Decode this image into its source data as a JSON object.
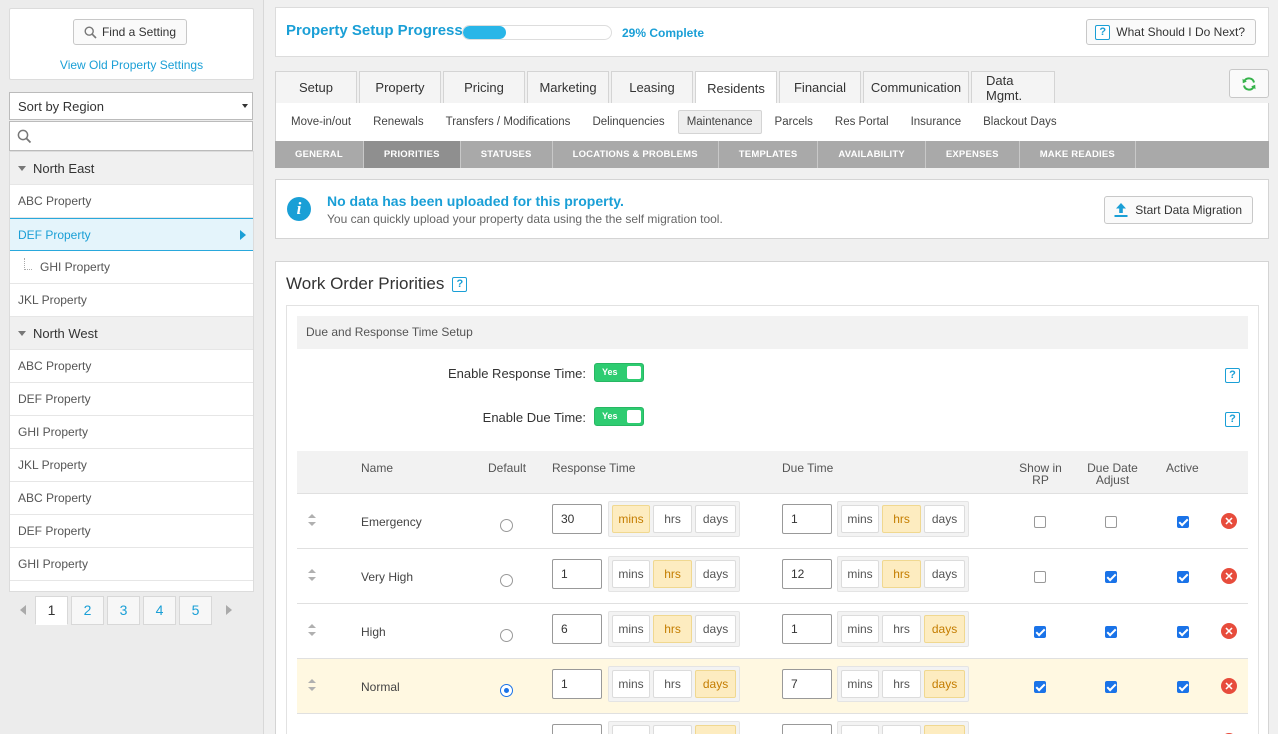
{
  "sidebar": {
    "find_label": "Find a Setting",
    "old_link": "View Old Property Settings",
    "sort_value": "Sort by Region",
    "search_placeholder": "",
    "tree": [
      {
        "label": "North East",
        "type": "region"
      },
      {
        "label": "ABC Property",
        "type": "item"
      },
      {
        "label": "DEF Property",
        "type": "active"
      },
      {
        "label": "GHI Property",
        "type": "child"
      },
      {
        "label": "JKL Property",
        "type": "item"
      },
      {
        "label": "North West",
        "type": "region"
      },
      {
        "label": "ABC Property",
        "type": "item"
      },
      {
        "label": "DEF Property",
        "type": "item"
      },
      {
        "label": "GHI Property",
        "type": "item"
      },
      {
        "label": "JKL Property",
        "type": "item"
      },
      {
        "label": "ABC Property",
        "type": "item"
      },
      {
        "label": "DEF Property",
        "type": "item"
      },
      {
        "label": "GHI Property",
        "type": "item"
      }
    ],
    "pages": [
      "1",
      "2",
      "3",
      "4",
      "5"
    ],
    "current_page": "1"
  },
  "progress": {
    "title": "Property Setup Progress",
    "percent": 29,
    "label": "29% Complete",
    "help_button": "What Should I Do Next?"
  },
  "tabs": [
    "Setup",
    "Property",
    "Pricing",
    "Marketing",
    "Leasing",
    "Residents",
    "Financial",
    "Communication",
    "Data Mgmt."
  ],
  "active_tab": "Residents",
  "subtabs": [
    "Move-in/out",
    "Renewals",
    "Transfers / Modifications",
    "Delinquencies",
    "Maintenance",
    "Parcels",
    "Res Portal",
    "Insurance",
    "Blackout Days"
  ],
  "active_subtab": "Maintenance",
  "subsubtabs": [
    "GENERAL",
    "PRIORITIES",
    "STATUSES",
    "LOCATIONS & PROBLEMS",
    "TEMPLATES",
    "AVAILABILITY",
    "EXPENSES",
    "MAKE READIES"
  ],
  "active_subsubtab": "PRIORITIES",
  "alert": {
    "title": "No data has been uploaded for this property.",
    "text": "You can quickly upload your property data using the the self migration tool.",
    "button": "Start Data Migration"
  },
  "panel": {
    "title": "Work Order Priorities",
    "section_title": "Due and Response Time Setup",
    "enable_response_label": "Enable Response Time:",
    "enable_response_value": "Yes",
    "enable_due_label": "Enable Due Time:",
    "enable_due_value": "Yes",
    "columns": {
      "name": "Name",
      "default": "Default",
      "response": "Response Time",
      "due": "Due Time",
      "show_rp": "Show in RP",
      "due_adjust": "Due Date Adjust",
      "active": "Active"
    },
    "units": [
      "mins",
      "hrs",
      "days"
    ],
    "rows": [
      {
        "name": "Emergency",
        "default": false,
        "response_value": "30",
        "response_unit": "mins",
        "due_value": "1",
        "due_unit": "hrs",
        "show_rp": false,
        "due_adjust": false,
        "active": true
      },
      {
        "name": "Very High",
        "default": false,
        "response_value": "1",
        "response_unit": "hrs",
        "due_value": "12",
        "due_unit": "hrs",
        "show_rp": false,
        "due_adjust": true,
        "active": true
      },
      {
        "name": "High",
        "default": false,
        "response_value": "6",
        "response_unit": "hrs",
        "due_value": "1",
        "due_unit": "days",
        "show_rp": true,
        "due_adjust": true,
        "active": true
      },
      {
        "name": "Normal",
        "default": true,
        "response_value": "1",
        "response_unit": "days",
        "due_value": "7",
        "due_unit": "days",
        "show_rp": true,
        "due_adjust": true,
        "active": true
      },
      {
        "name": "",
        "default": false,
        "response_value": "",
        "response_unit": "days",
        "due_value": "",
        "due_unit": "days",
        "show_rp": false,
        "due_adjust": false,
        "active": false
      }
    ]
  }
}
